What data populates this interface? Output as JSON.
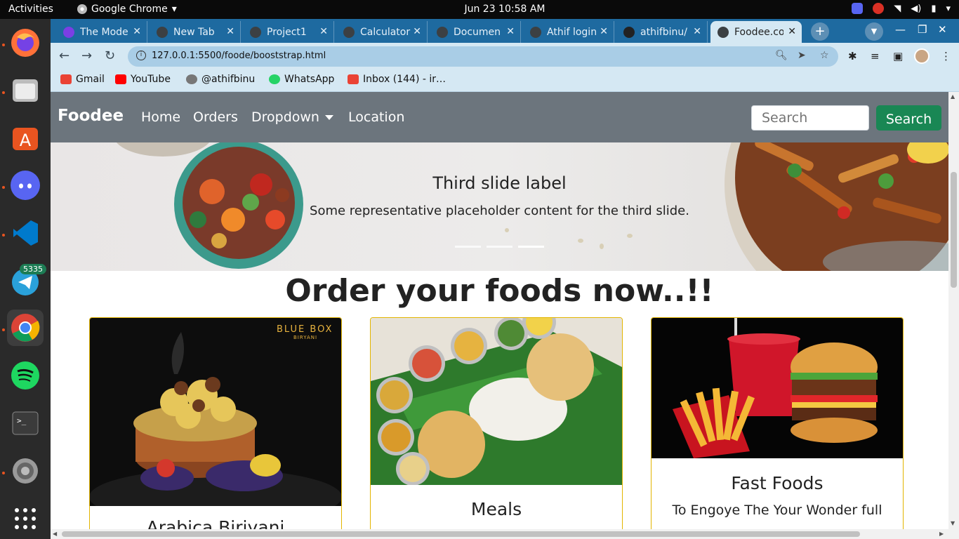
{
  "topbar": {
    "activities": "Activities",
    "app_name": "Google Chrome",
    "clock": "Jun 23  10:58 AM"
  },
  "dock": {
    "items": [
      "firefox-icon",
      "files-icon",
      "app-center-icon",
      "discord-icon",
      "vscode-icon",
      "telegram-icon",
      "chrome-icon",
      "spotify-icon",
      "terminal-icon",
      "settings-icon",
      "show-apps-icon"
    ],
    "telegram_badge": "5335"
  },
  "browser": {
    "tabs": [
      {
        "label": "The Mode"
      },
      {
        "label": "New Tab"
      },
      {
        "label": "Project1"
      },
      {
        "label": "Calculator"
      },
      {
        "label": "Documen"
      },
      {
        "label": "Athif login"
      },
      {
        "label": "athifbinu/"
      },
      {
        "label": "Foodee.co"
      }
    ],
    "url": "127.0.0.1:5500/foode/booststrap.html",
    "bookmarks": [
      {
        "label": "Gmail",
        "color": "#ea4335"
      },
      {
        "label": "YouTube",
        "color": "#ff0000"
      },
      {
        "label": "@athifbinu",
        "color": "#777777"
      },
      {
        "label": "WhatsApp",
        "color": "#25d366"
      },
      {
        "label": "Inbox (144) - ir…",
        "color": "#ea4335"
      }
    ]
  },
  "page": {
    "navbar": {
      "brand": "Foodee",
      "links": [
        "Home",
        "Orders",
        "Dropdown",
        "Location"
      ],
      "search_placeholder": "Search",
      "search_button": "Search",
      "bg_color": "#6c757d",
      "button_color": "#198754"
    },
    "carousel": {
      "title": "Third slide label",
      "text": "Some representative placeholder content for the third slide.",
      "slide_count": 3,
      "active_slide": 3
    },
    "heading": "Order your foods now..!!",
    "cards": [
      {
        "title": "Arabica Biriyani",
        "text": "",
        "brand_mark": "BLUE BOX",
        "brand_sub": "BIRYANI"
      },
      {
        "title": "Meals",
        "text": ""
      },
      {
        "title": "Fast Foods",
        "text": "To Engoye The Your Wonder full"
      }
    ]
  }
}
